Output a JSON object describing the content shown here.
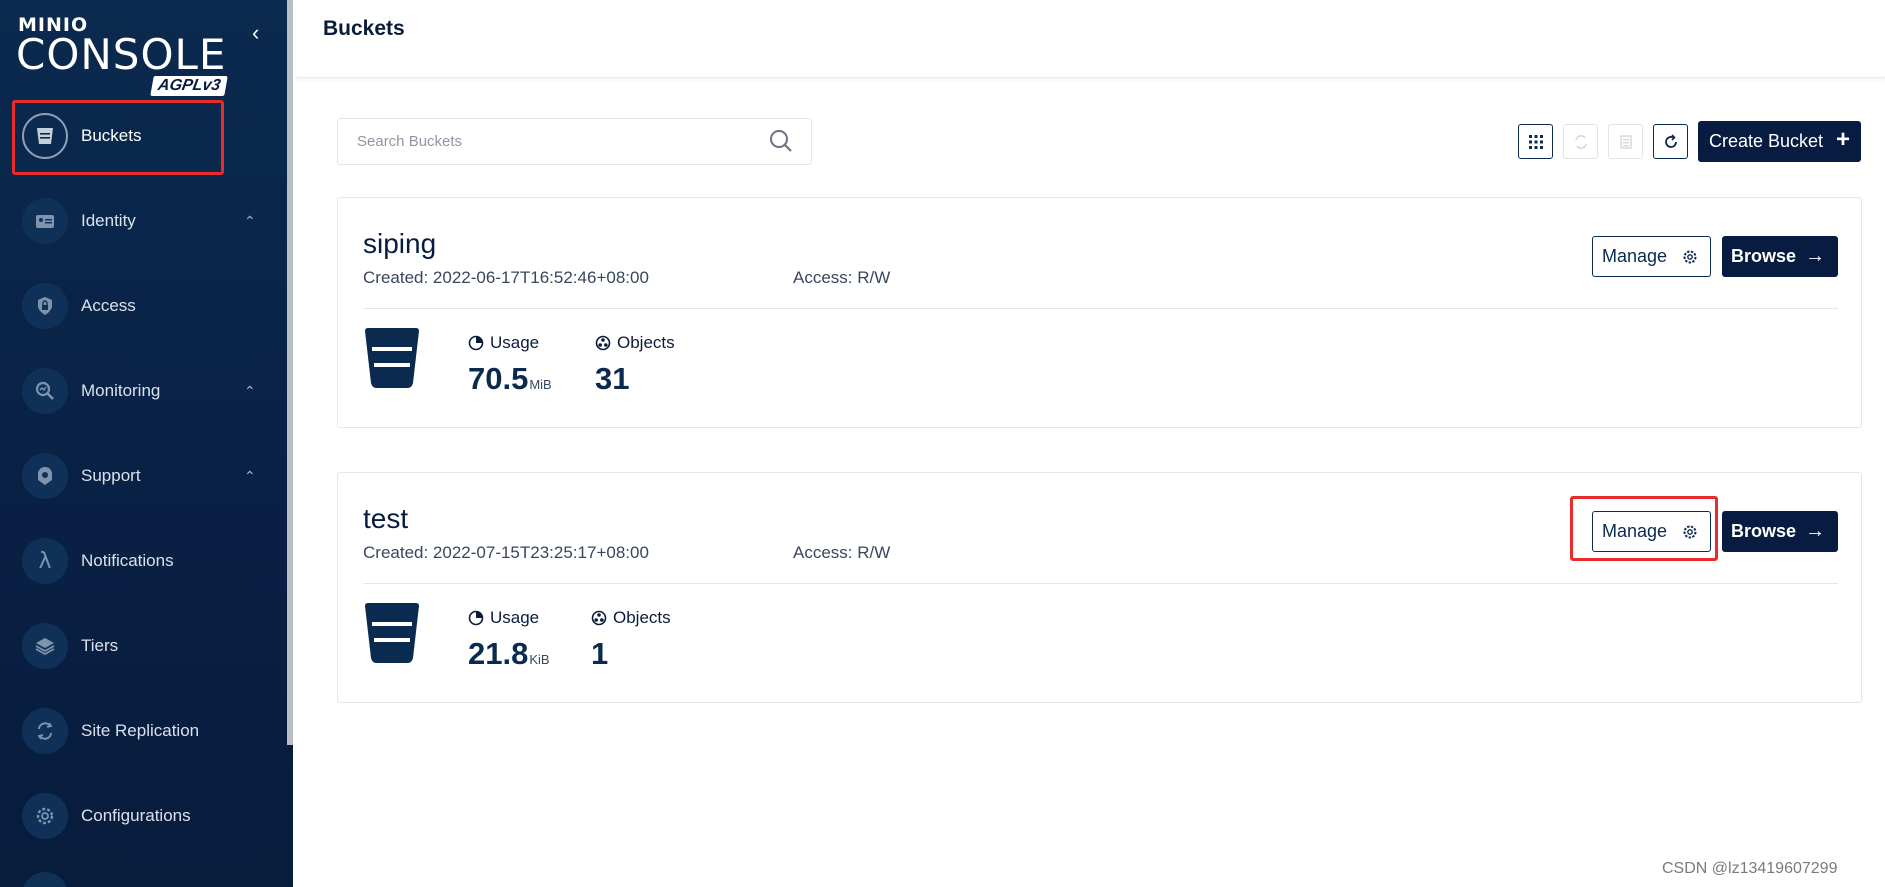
{
  "logo": {
    "brand": "MINIO",
    "product": "CONSOLE",
    "license": "AGPLv3"
  },
  "sidebar": {
    "collapse_icon": "chevron-left-icon",
    "items": [
      {
        "label": "Buckets",
        "icon": "bucket-icon",
        "active": true,
        "expandable": false
      },
      {
        "label": "Identity",
        "icon": "id-card-icon",
        "active": false,
        "expandable": true
      },
      {
        "label": "Access",
        "icon": "lock-shield-icon",
        "active": false,
        "expandable": false
      },
      {
        "label": "Monitoring",
        "icon": "magnifier-chart-icon",
        "active": false,
        "expandable": true
      },
      {
        "label": "Support",
        "icon": "support-shield-icon",
        "active": false,
        "expandable": true
      },
      {
        "label": "Notifications",
        "icon": "lambda-icon",
        "active": false,
        "expandable": false
      },
      {
        "label": "Tiers",
        "icon": "layers-icon",
        "active": false,
        "expandable": false
      },
      {
        "label": "Site Replication",
        "icon": "replication-icon",
        "active": false,
        "expandable": false
      },
      {
        "label": "Configurations",
        "icon": "gear-icon",
        "active": false,
        "expandable": false
      }
    ]
  },
  "header": {
    "title": "Buckets"
  },
  "search": {
    "placeholder": "Search Buckets",
    "value": ""
  },
  "toolbar": {
    "view_icon": "grid-icon",
    "replicate_icon": "replicate-icon",
    "lifecycle_icon": "lifecycle-icon",
    "refresh_icon": "refresh-icon",
    "create_label": "Create Bucket",
    "create_icon": "plus-icon"
  },
  "buckets": [
    {
      "name": "siping",
      "created": "Created: 2022-06-17T16:52:46+08:00",
      "access": "Access: R/W",
      "usage_label": "Usage",
      "usage_value": "70.5",
      "usage_unit": "MiB",
      "objects_label": "Objects",
      "objects_value": "31",
      "manage_label": "Manage",
      "browse_label": "Browse"
    },
    {
      "name": "test",
      "created": "Created: 2022-07-15T23:25:17+08:00",
      "access": "Access: R/W",
      "usage_label": "Usage",
      "usage_value": "21.8",
      "usage_unit": "KiB",
      "objects_label": "Objects",
      "objects_value": "1",
      "manage_label": "Manage",
      "browse_label": "Browse"
    }
  ],
  "watermark": "CSDN @lz13419607299",
  "colors": {
    "sidebar_bg": "#0b2a4f",
    "primary": "#081c42",
    "highlight": "#e82b2b"
  }
}
